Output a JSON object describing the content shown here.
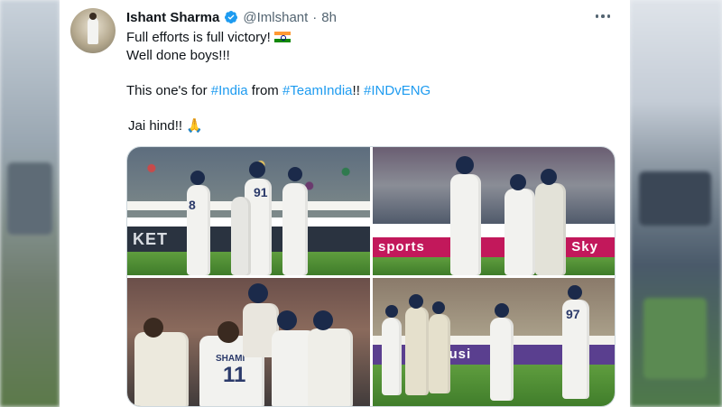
{
  "tweet": {
    "author_name": "Ishant Sharma",
    "handle": "@Imlshant",
    "separator": "·",
    "time": "8h",
    "lines": {
      "line1": "Full efforts is full victory!",
      "line2": "Well done boys!!!",
      "line3_prefix": "This one's for ",
      "line3_tag1": "#India",
      "line3_mid": " from ",
      "line3_tag2": "#TeamIndia",
      "line3_bang": "!! ",
      "line3_tag3": "#INDvENG",
      "line4": "Jai hind!!"
    },
    "emoji": {
      "flag": "india-flag-icon",
      "hands": "🙏"
    }
  },
  "media": {
    "photos": [
      {
        "id": "photo-1",
        "board_text": "KET",
        "jersey_numbers": [
          "8",
          "91"
        ]
      },
      {
        "id": "photo-2",
        "board_text": "sports",
        "board_text_right": "Sky"
      },
      {
        "id": "photo-3",
        "jersey_name": "SHAMI",
        "jersey_number": "11"
      },
      {
        "id": "photo-4",
        "board_text": "clusi",
        "jersey_number": "97"
      }
    ]
  },
  "colors": {
    "accent": "#1d9bf0",
    "verified": "#1d9bf0",
    "text": "#0f1419",
    "muted": "#536471"
  }
}
